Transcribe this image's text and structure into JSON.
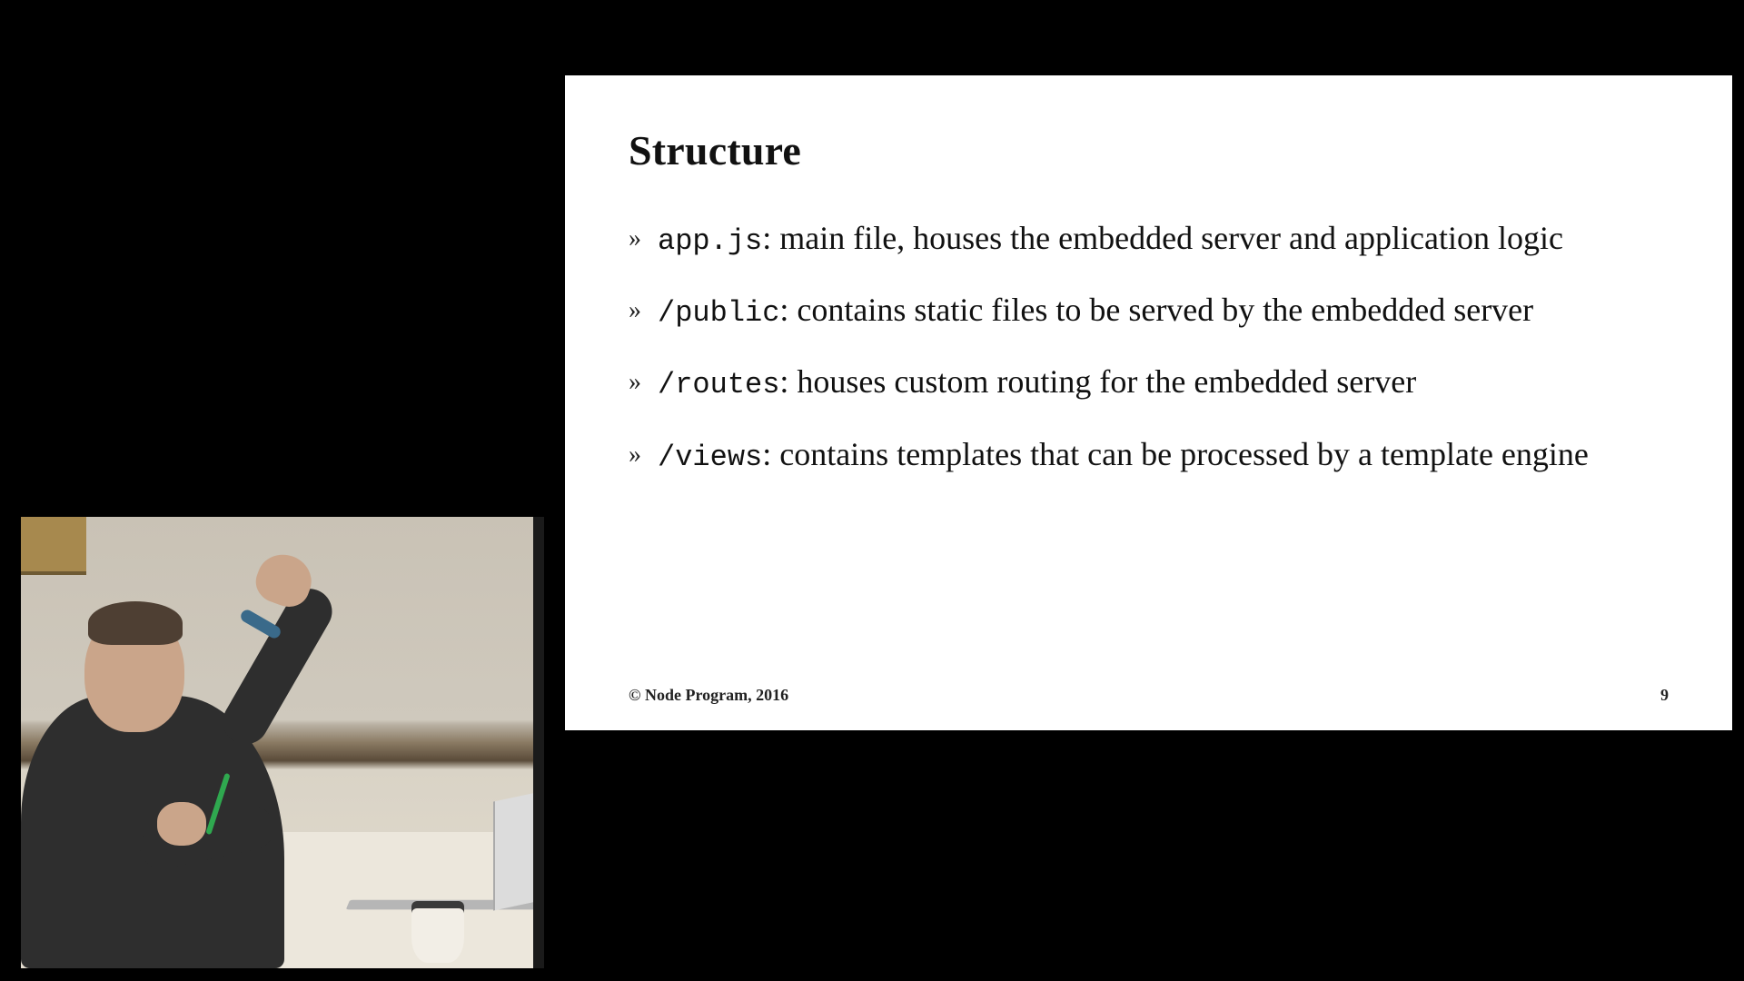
{
  "slide": {
    "title": "Structure",
    "bullet_marker": "»",
    "items": [
      {
        "code": "app.js",
        "text": ": main file, houses the embedded server and application logic"
      },
      {
        "code": "/public",
        "text": ": contains static files to be served by the embedded server"
      },
      {
        "code": "/routes",
        "text": ": houses custom routing for the embedded server"
      },
      {
        "code": "/views",
        "text": ": contains templates that can be processed by a template engine"
      }
    ],
    "copyright": "© Node Program, 2016",
    "page_number": "9"
  }
}
